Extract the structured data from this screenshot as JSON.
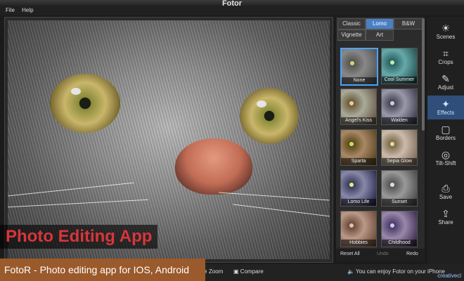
{
  "app": {
    "title": "Fotor"
  },
  "menu": [
    "File",
    "Help"
  ],
  "right_panel": {
    "tabs": [
      "Classic",
      "Lomo",
      "B&W",
      "Vignette",
      "Art"
    ],
    "active_tab": "Lomo",
    "effects": [
      "None",
      "Cool Summer",
      "Angel's Kiss",
      "Walden",
      "Sparta",
      "Sepia Glow",
      "Lomo Life",
      "Sunset",
      "Hobbies",
      "Childhood"
    ],
    "selected_effect": "None",
    "reset_all": "Reset All",
    "undo": "Undo",
    "redo": "Redo"
  },
  "toolbar": [
    {
      "label": "Scenes",
      "icon": "sun-icon"
    },
    {
      "label": "Crops",
      "icon": "crop-icon"
    },
    {
      "label": "Adjust",
      "icon": "pencil-icon"
    },
    {
      "label": "Effects",
      "icon": "sparkle-icon"
    },
    {
      "label": "Borders",
      "icon": "border-icon"
    },
    {
      "label": "Tilt-Shift",
      "icon": "target-icon"
    },
    {
      "label": "Save",
      "icon": "save-icon"
    },
    {
      "label": "Share",
      "icon": "share-icon"
    }
  ],
  "active_tool": "Effects",
  "bottom_bar": {
    "zoom": "Zoom",
    "compare": "Compare",
    "status": "You can enjoy Fotor on your iPhone"
  },
  "overlay": {
    "title": "Photo Editing App",
    "subtitle": "FotoR - Photo editing app for IOS, Android",
    "watermark": "creativecl"
  },
  "colors": {
    "accent": "#4a7fc4",
    "overlay_title": "#d9353a",
    "overlay_sub_bg": "#9a5a2b"
  }
}
